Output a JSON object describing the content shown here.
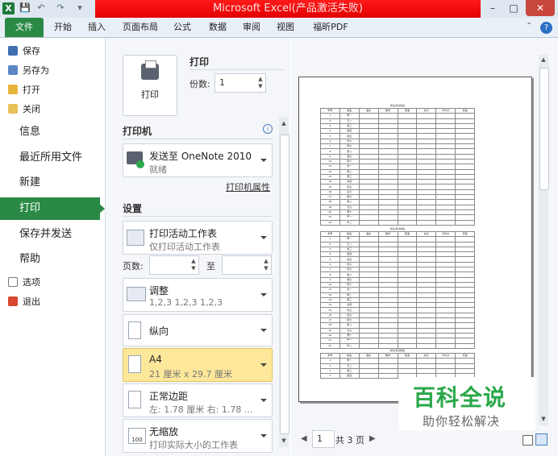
{
  "window": {
    "title": "Microsoft Excel(产品激活失败)",
    "app_icon": "X",
    "controls": [
      "–",
      "□",
      "✕"
    ]
  },
  "ribbon": {
    "tabs": [
      "文件",
      "开始",
      "插入",
      "页面布局",
      "公式",
      "数据",
      "审阅",
      "视图",
      "福昕PDF"
    ]
  },
  "nav": {
    "top_items": [
      "保存",
      "另存为",
      "打开",
      "关闭"
    ],
    "big_items": [
      "信息",
      "最近所用文件",
      "新建",
      "打印",
      "保存并发送",
      "帮助"
    ],
    "bottom_items": [
      "选项",
      "退出"
    ]
  },
  "print": {
    "section_title": "打印",
    "button_label": "打印",
    "copies_label": "份数:",
    "copies_value": "1",
    "printer_title": "打印机",
    "printer_name": "发送至 OneNote 2010",
    "printer_status": "就绪",
    "printer_props": "打印机属性",
    "settings_title": "设置",
    "scope_main": "打印活动工作表",
    "scope_sub": "仅打印活动工作表",
    "pages_label": "页数:",
    "pages_to": "至",
    "collate_main": "调整",
    "collate_sub": "1,2,3    1,2,3    1,2,3",
    "orientation": "纵向",
    "paper_main": "A4",
    "paper_sub": "21 厘米 x 29.7 厘米",
    "margin_main": "正常边距",
    "margin_sub": "左: 1.78 厘米    右: 1.78 ...",
    "scale_main": "无缩放",
    "scale_sub": "打印实际大小的工作表"
  },
  "preview": {
    "page_current": "1",
    "page_total": "共 3 页"
  },
  "sheet": {
    "title": "新生考试成绩",
    "headers": [
      "学号",
      "姓名",
      "语文",
      "数学",
      "英语",
      "总分",
      "平均分",
      "评语"
    ],
    "names": [
      "李一",
      "王二",
      "张三",
      "赵四",
      "钱五",
      "孙六",
      "周七",
      "吴八",
      "郑九",
      "陈十",
      "刘一",
      "杨二",
      "黄三",
      "许四",
      "何五",
      "吕六",
      "施七",
      "张八",
      "孔九",
      "曹十",
      "严一",
      "华二"
    ]
  },
  "watermark": {
    "title": "百科全说",
    "subtitle": "助你轻松解决"
  },
  "colors": {
    "accent": "#2a8a45",
    "title_red": "#e30000",
    "highlight": "#fde79a"
  }
}
